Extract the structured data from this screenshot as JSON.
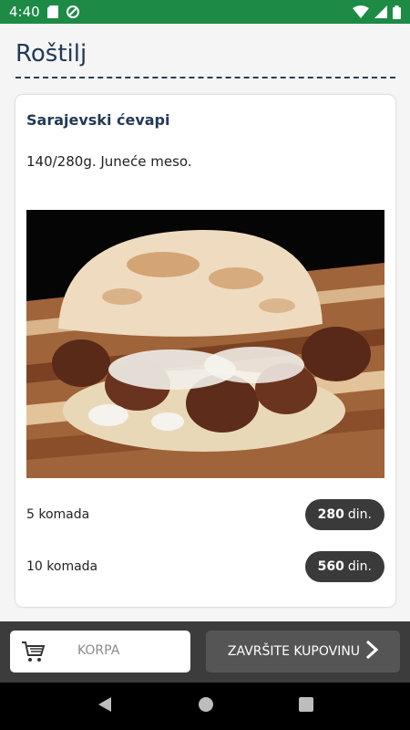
{
  "status_bar": {
    "time": "4:40",
    "icons": [
      "sd-card-icon",
      "data-saver-icon",
      "wifi-icon",
      "signal-icon",
      "battery-icon"
    ],
    "background": "#1d8a45"
  },
  "page": {
    "title": "Roštilj"
  },
  "item": {
    "name": "Sarajevski ćevapi",
    "description": "140/280g. Juneće meso.",
    "image": "cevapi-in-somun-photo",
    "options": [
      {
        "label": "5 komada",
        "price": "280",
        "currency": "din."
      },
      {
        "label": "10 komada",
        "price": "560",
        "currency": "din."
      }
    ]
  },
  "bottom_bar": {
    "cart_label": "KORPA",
    "checkout_label": "ZAVRŠITE KUPOVINU"
  },
  "nav": {
    "buttons": [
      "back-icon",
      "home-icon",
      "recents-icon"
    ]
  }
}
